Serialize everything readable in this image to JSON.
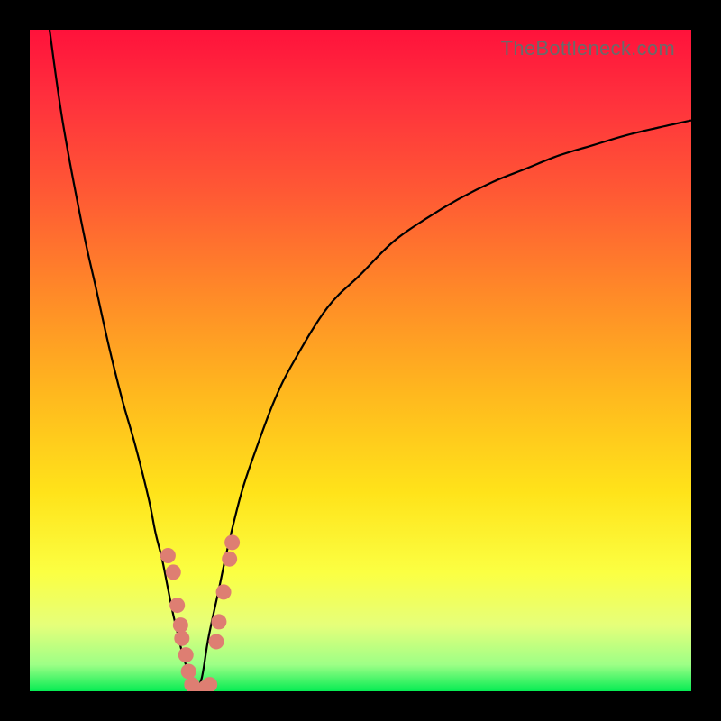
{
  "watermark": "TheBottleneck.com",
  "chart_data": {
    "type": "line",
    "title": "",
    "xlabel": "",
    "ylabel": "",
    "xlim": [
      0,
      100
    ],
    "ylim": [
      0,
      100
    ],
    "gradient_note": "background vertical gradient: green (bottleneck 0%) at bottom -> red (bottleneck 100%) at top",
    "series": [
      {
        "name": "left-curve",
        "x": [
          3,
          5,
          8,
          10,
          12,
          14,
          16,
          18,
          19,
          20,
          20.8,
          21.6,
          22.3,
          23.0,
          23.6,
          24.2,
          24.6,
          25.0
        ],
        "y": [
          100,
          86,
          70,
          61,
          52,
          44,
          37,
          29,
          24,
          20,
          16,
          12,
          9,
          6,
          4,
          2,
          0.8,
          0
        ]
      },
      {
        "name": "right-curve",
        "x": [
          25.0,
          26,
          27,
          28.5,
          30,
          32,
          34,
          37,
          40,
          45,
          50,
          55,
          60,
          65,
          70,
          75,
          80,
          85,
          90,
          95,
          100
        ],
        "y": [
          0,
          2,
          8,
          15,
          22,
          30,
          36,
          44,
          50,
          58,
          63,
          68,
          71.5,
          74.5,
          77,
          79,
          81,
          82.5,
          84,
          85.2,
          86.3
        ]
      }
    ],
    "scatter_points": {
      "name": "highlighted-points",
      "color": "#de7e72",
      "points": [
        {
          "x": 20.9,
          "y": 20.5
        },
        {
          "x": 21.7,
          "y": 18.0
        },
        {
          "x": 22.3,
          "y": 13.0
        },
        {
          "x": 22.8,
          "y": 10.0
        },
        {
          "x": 23.0,
          "y": 8.0
        },
        {
          "x": 23.6,
          "y": 5.5
        },
        {
          "x": 24.0,
          "y": 3.0
        },
        {
          "x": 24.5,
          "y": 1.0
        },
        {
          "x": 25.0,
          "y": 0.0
        },
        {
          "x": 25.5,
          "y": 0.0
        },
        {
          "x": 26.0,
          "y": 0.0
        },
        {
          "x": 26.5,
          "y": 0.5
        },
        {
          "x": 27.2,
          "y": 1.0
        },
        {
          "x": 28.2,
          "y": 7.5
        },
        {
          "x": 28.6,
          "y": 10.5
        },
        {
          "x": 29.3,
          "y": 15.0
        },
        {
          "x": 30.2,
          "y": 20.0
        },
        {
          "x": 30.6,
          "y": 22.5
        }
      ]
    }
  }
}
